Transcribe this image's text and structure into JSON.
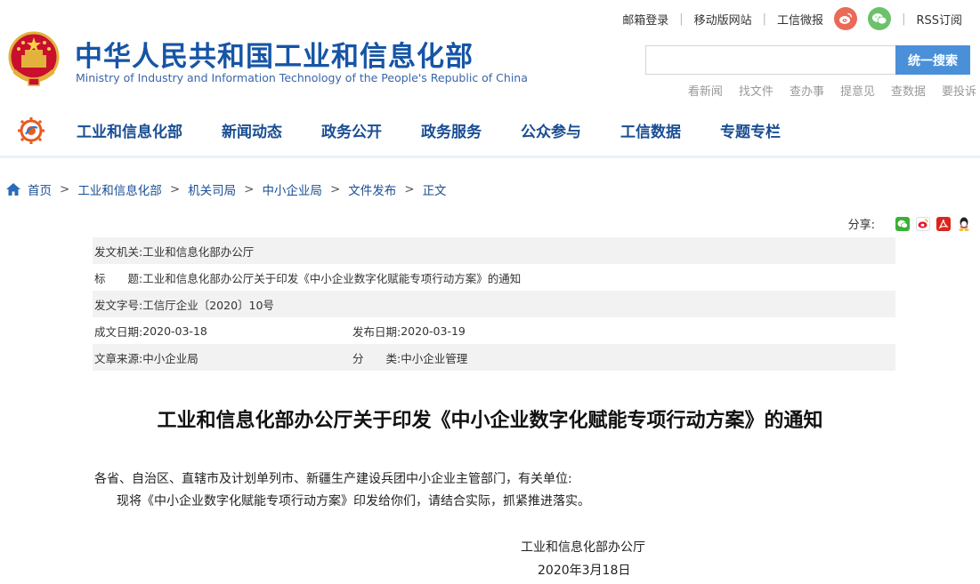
{
  "top_links": {
    "mail_login": "邮箱登录",
    "mobile": "移动版网站",
    "weibo": "工信微报",
    "rss": "RSS订阅"
  },
  "header": {
    "title_cn": "中华人民共和国工业和信息化部",
    "title_en": "Ministry of Industry and Information Technology of the People's Republic of China"
  },
  "search": {
    "value": "",
    "button": "统一搜索"
  },
  "quick_links": [
    "看新闻",
    "找文件",
    "查办事",
    "提意见",
    "查数据",
    "要投诉"
  ],
  "nav": {
    "items": [
      "工业和信息化部",
      "新闻动态",
      "政务公开",
      "政务服务",
      "公众参与",
      "工信数据",
      "专题专栏"
    ]
  },
  "breadcrumb": {
    "items": [
      "首页",
      "工业和信息化部",
      "机关司局",
      "中小企业局",
      "文件发布"
    ],
    "current": "正文",
    "separator": ">"
  },
  "share": {
    "label": "分享:"
  },
  "meta": {
    "issuer_label": "发文机关:",
    "issuer": "工业和信息化部办公厅",
    "title_label": "标　　题:",
    "title": "工业和信息化部办公厅关于印发《中小企业数字化赋能专项行动方案》的通知",
    "doc_no_label": "发文字号:",
    "doc_no": "工信厅企业〔2020〕10号",
    "created_label": "成文日期:",
    "created": "2020-03-18",
    "published_label": "发布日期:",
    "published": "2020-03-19",
    "source_label": "文章来源:",
    "source": "中小企业局",
    "category_label": "分　　类:",
    "category": "中小企业管理"
  },
  "article": {
    "title": "工业和信息化部办公厅关于印发《中小企业数字化赋能专项行动方案》的通知",
    "para1": "各省、自治区、直辖市及计划单列市、新疆生产建设兵团中小企业主管部门，有关单位:",
    "para2": "现将《中小企业数字化赋能专项行动方案》印发给你们，请结合实际，抓紧推进落实。",
    "signature": "工业和信息化部办公厅",
    "date": "2020年3月18日"
  },
  "colors": {
    "brand_blue": "#1655a6",
    "nav_blue": "#1a4e93",
    "search_button": "#4a90d9",
    "weibo": "#ea6a57",
    "wechat": "#6cc16a"
  }
}
